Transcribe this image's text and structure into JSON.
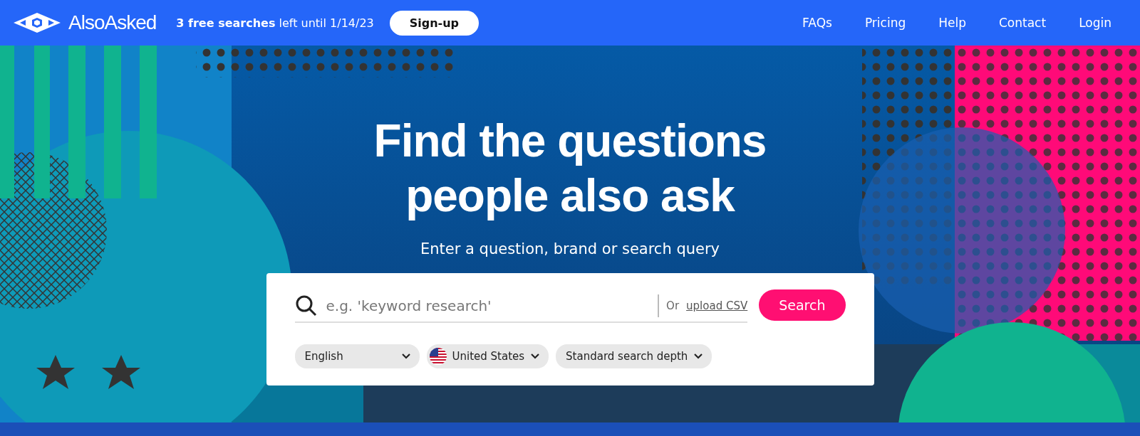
{
  "header": {
    "brand": "AlsoAsked",
    "notice": "**3 free searches** left until 1/14/23",
    "signup": "Sign-up",
    "nav": [
      {
        "label": "FAQs"
      },
      {
        "label": "Pricing"
      },
      {
        "label": "Help"
      },
      {
        "label": "Contact"
      },
      {
        "label": "Login"
      }
    ]
  },
  "hero": {
    "title": "Find the questions people also ask",
    "subtitle": "Enter a question, brand or search query"
  },
  "search": {
    "placeholder": "e.g. 'keyword research'",
    "or": "Or",
    "upload_link": "upload CSV",
    "button": "Search",
    "options": [
      {
        "kind": "plain",
        "label": "English"
      },
      {
        "kind": "flag",
        "label": "United States"
      },
      {
        "kind": "plain",
        "label": "Standard search depth"
      }
    ]
  }
}
